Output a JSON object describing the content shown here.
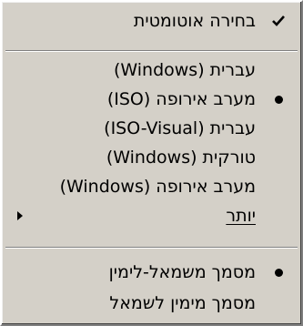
{
  "menu": {
    "auto_select": {
      "label": "בחירה אוטומטית",
      "checked": true,
      "mark_icon": "checkmark-icon"
    },
    "encodings": [
      {
        "label": "עברית (Windows)",
        "selected": false
      },
      {
        "label": "מערב אירופה (ISO)",
        "selected": true
      },
      {
        "label": "עברית (ISO-Visual)",
        "selected": false
      },
      {
        "label": "טורקית (Windows)",
        "selected": false
      },
      {
        "label": "מערב אירופה (Windows)",
        "selected": false
      }
    ],
    "more": {
      "label": "יותר",
      "submenu_icon": "submenu-arrow-icon"
    },
    "directions": [
      {
        "label": "מסמך משמאל-לימין",
        "selected": true
      },
      {
        "label": "מסמך מימין לשמאל",
        "selected": false
      }
    ],
    "colors": {
      "background": "#d4d0c8",
      "text": "#000000",
      "separator_dark": "#808080",
      "separator_light": "#ffffff"
    }
  }
}
